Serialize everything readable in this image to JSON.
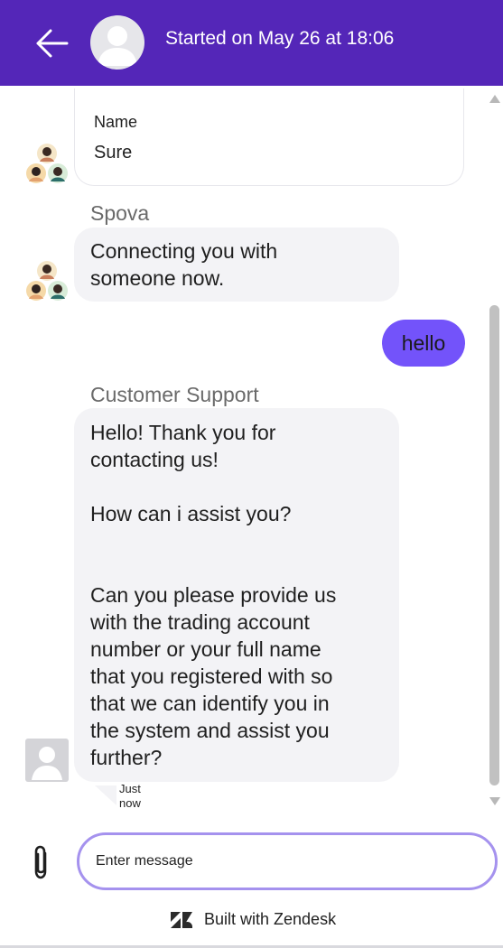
{
  "header": {
    "title": "Started on May 26 at 18:06",
    "background": "#5426b8",
    "back_icon": "arrow-left-icon",
    "avatar_icon": "person-placeholder-icon"
  },
  "messages": {
    "form": {
      "label": "Name",
      "value": "Sure"
    },
    "bot": {
      "sender": "Spova",
      "lines": [
        "Connecting you with",
        "someone now."
      ]
    },
    "user": {
      "text": "hello",
      "color": "#7353fa"
    },
    "agent": {
      "sender": "Customer Support",
      "lines": [
        "Hello! Thank you for",
        "contacting us!",
        "",
        "How can i assist you?",
        "",
        "",
        "Can you please provide us",
        "with the trading account",
        "number or your full name",
        "that you registered with so",
        "that we can identify you in",
        "the system and assist you",
        "further?"
      ],
      "receipt_lines": [
        "Just",
        "now"
      ]
    }
  },
  "composer": {
    "placeholder": "Enter message",
    "attach_icon": "paperclip-icon",
    "border_color": "#a592ee"
  },
  "footer": {
    "text": "Built with Zendesk",
    "logo_icon": "zendesk-logo-icon"
  }
}
